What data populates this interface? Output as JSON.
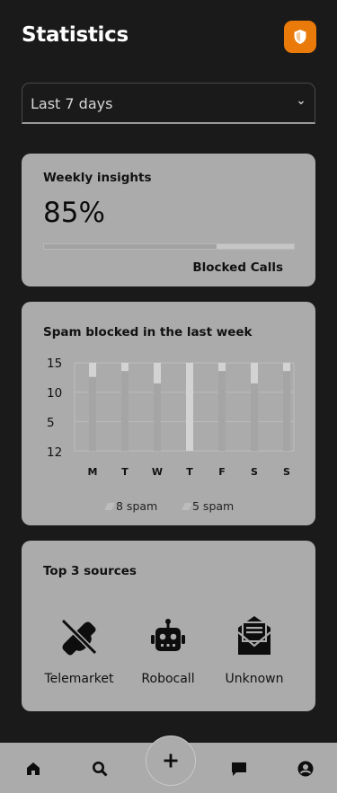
{
  "header": {
    "title": "Statistics",
    "shield_icon": "shield-icon",
    "accent": "#EA7A0A"
  },
  "period_select": {
    "value": "Last 7 days",
    "icon": "chevron-down-icon"
  },
  "weekly_insights": {
    "title": "Weekly insights",
    "percent_text": "85%",
    "progress_fraction": 0.69,
    "bar_label": "Blocked Calls"
  },
  "spam_chart": {
    "title": "Spam blocked in the last week",
    "legend": [
      {
        "label": "8 spam"
      },
      {
        "label": "5 spam"
      }
    ]
  },
  "chart_data": {
    "type": "bar",
    "title": "Spam blocked in the last week",
    "categories": [
      "M",
      "T",
      "W",
      "T",
      "F",
      "S",
      "S"
    ],
    "y_tick_labels": [
      "15",
      "10",
      "5",
      "12"
    ],
    "series": [
      {
        "name": "8 spam",
        "values": [
          12.6,
          13.6,
          11.5,
          15,
          13.6,
          11.5,
          13.6
        ]
      },
      {
        "name": "5 spam",
        "values": [
          2.4,
          1.4,
          3.5,
          0,
          1.4,
          3.5,
          1.4
        ]
      }
    ],
    "ylim": [
      0,
      15
    ],
    "grid": true,
    "legend_position": "bottom"
  },
  "top_sources": {
    "title": "Top 3 sources",
    "items": [
      {
        "label": "Telemarket",
        "icon": "phone-disabled-icon"
      },
      {
        "label": "Robocall",
        "icon": "robot-icon"
      },
      {
        "label": "Unknown",
        "icon": "envelope-open-icon"
      }
    ]
  },
  "bottom_nav": {
    "items": [
      {
        "icon": "home-icon"
      },
      {
        "icon": "search-icon"
      },
      {
        "icon": "plus-icon"
      },
      {
        "icon": "chat-icon"
      },
      {
        "icon": "account-icon"
      }
    ]
  }
}
